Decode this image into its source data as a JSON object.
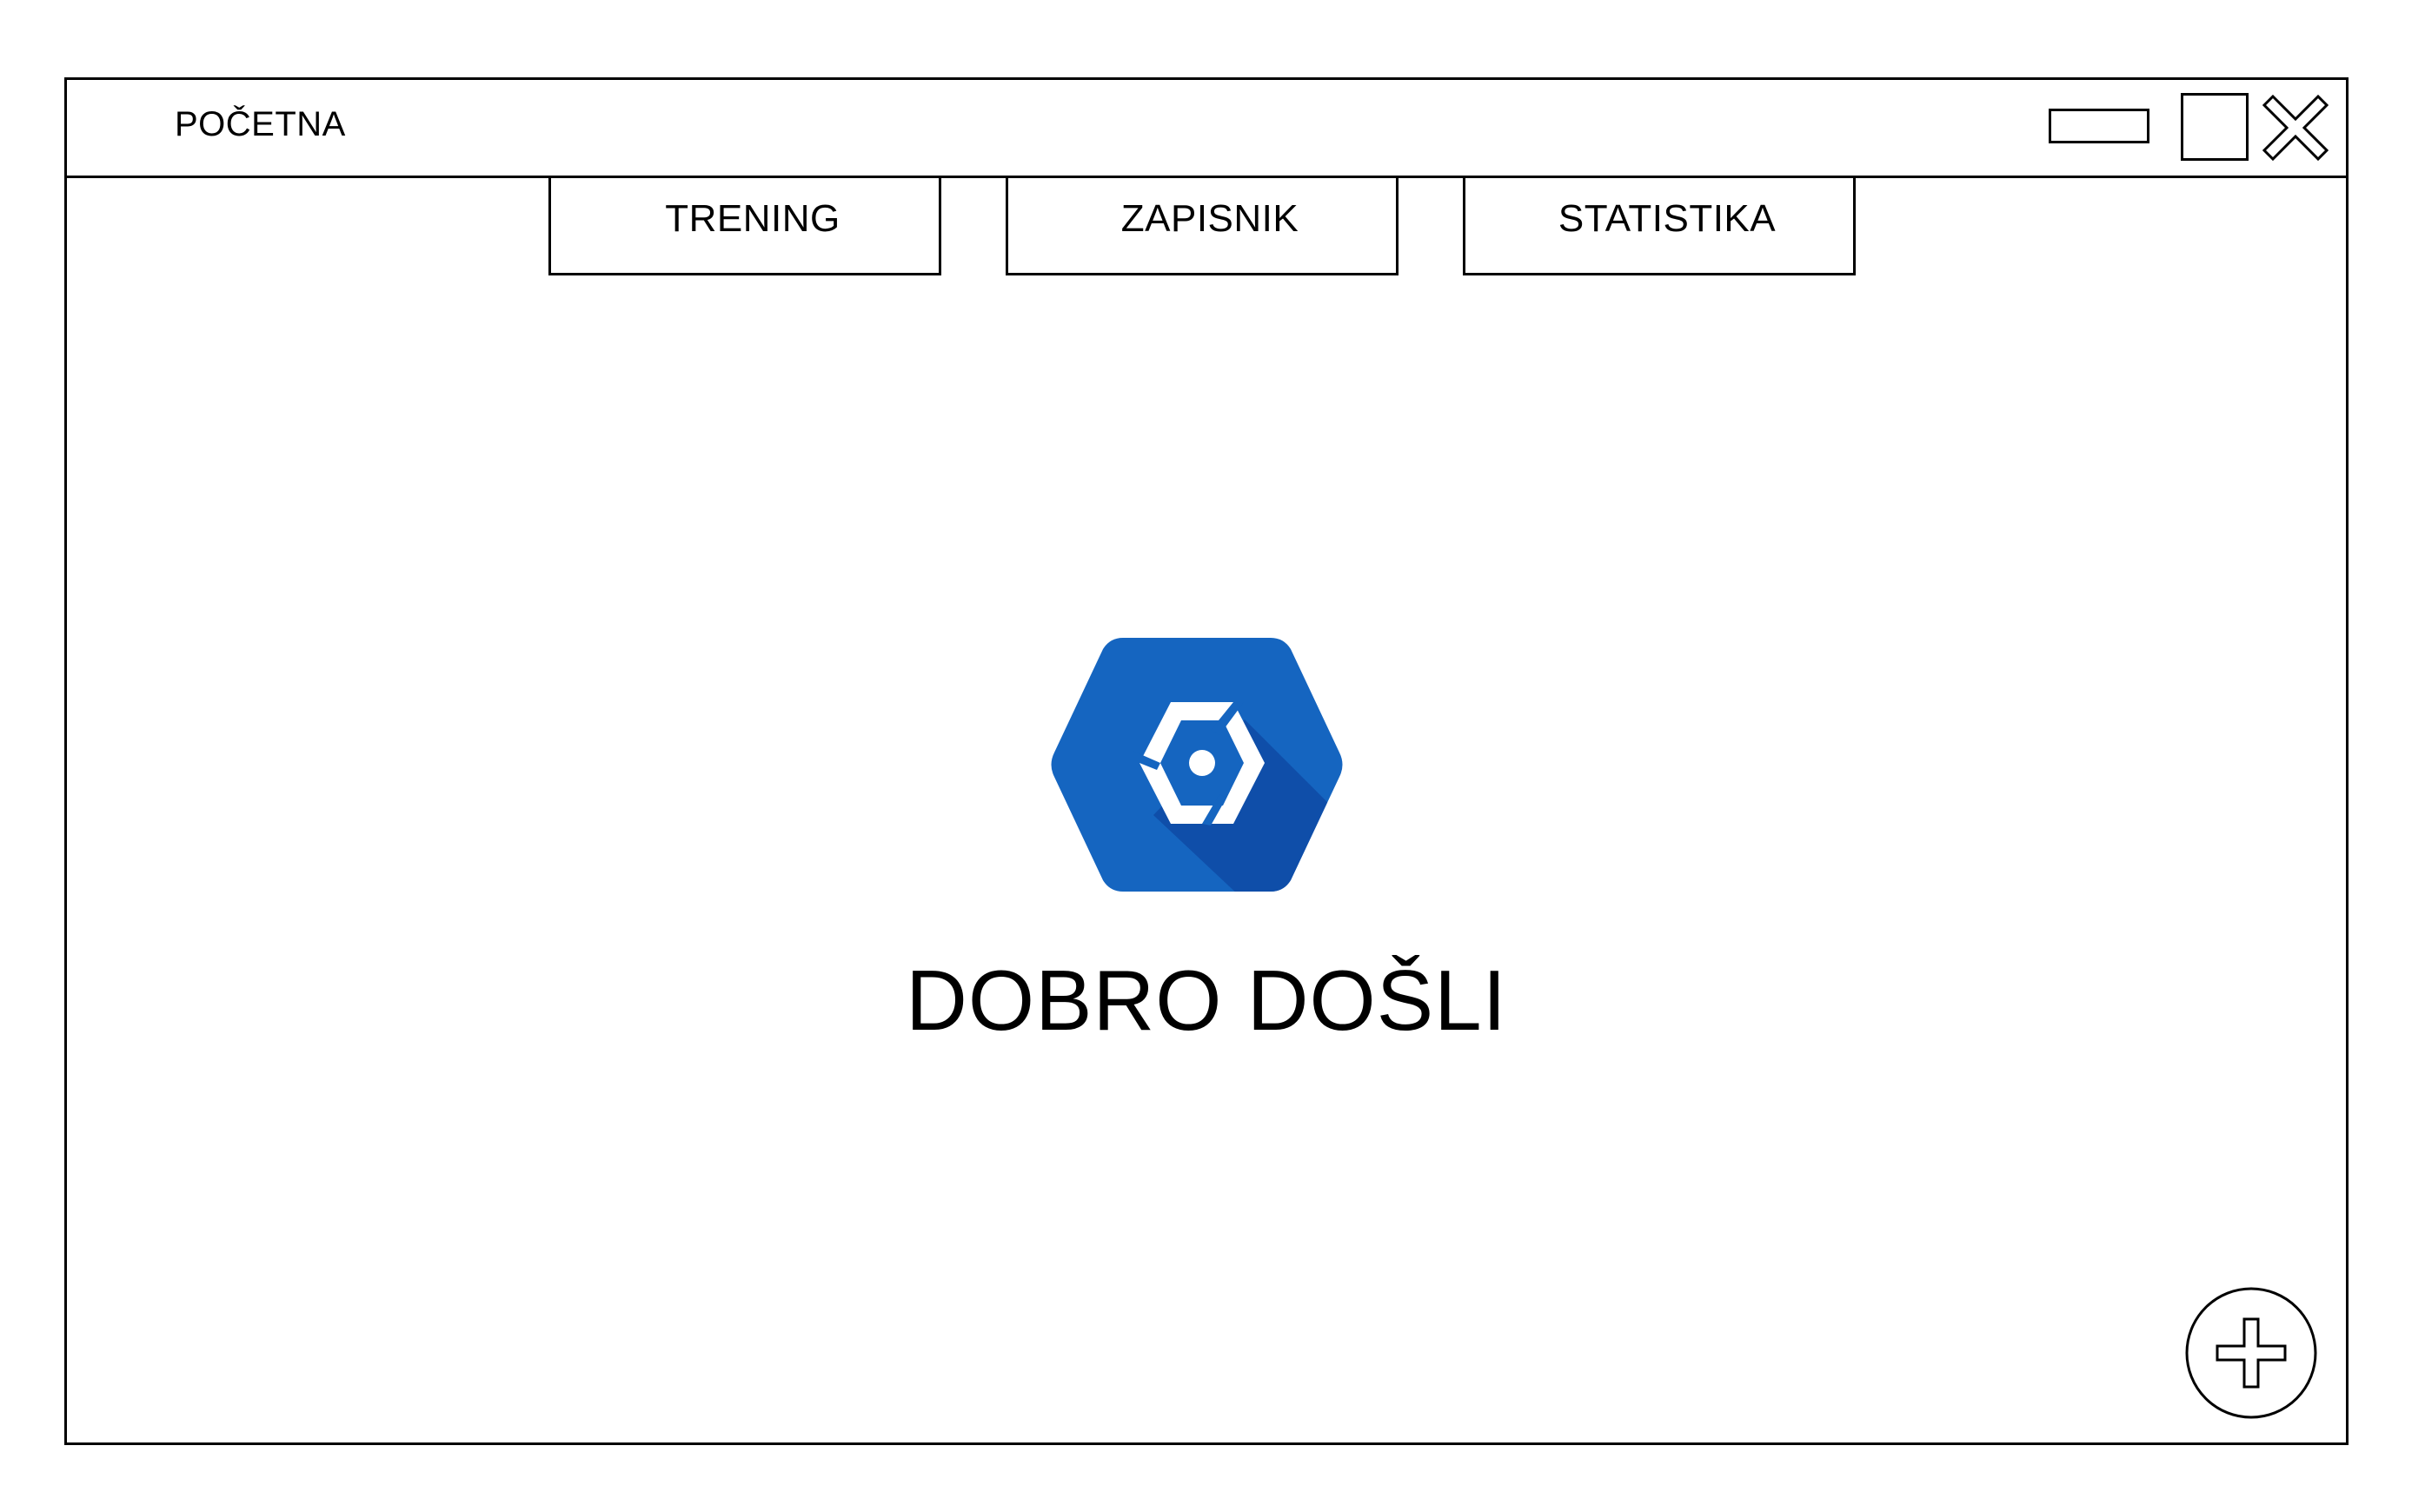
{
  "window": {
    "title": "POČETNA",
    "controls": {
      "minimize_icon": "minimize-icon",
      "maximize_icon": "maximize-icon",
      "close_icon": "close-icon"
    }
  },
  "tabs": [
    {
      "label": "TRENING"
    },
    {
      "label": "ZAPISNIK"
    },
    {
      "label": "STATISTIKA"
    }
  ],
  "main": {
    "logo_icon": "hexagon-logo-icon",
    "welcome_text": "DOBRO DOŠLI"
  },
  "fab": {
    "icon": "plus-icon"
  },
  "colors": {
    "logo_blue": "#1565C0",
    "logo_shadow": "#0D47A1",
    "border": "#000000",
    "background": "#FFFFFF"
  }
}
